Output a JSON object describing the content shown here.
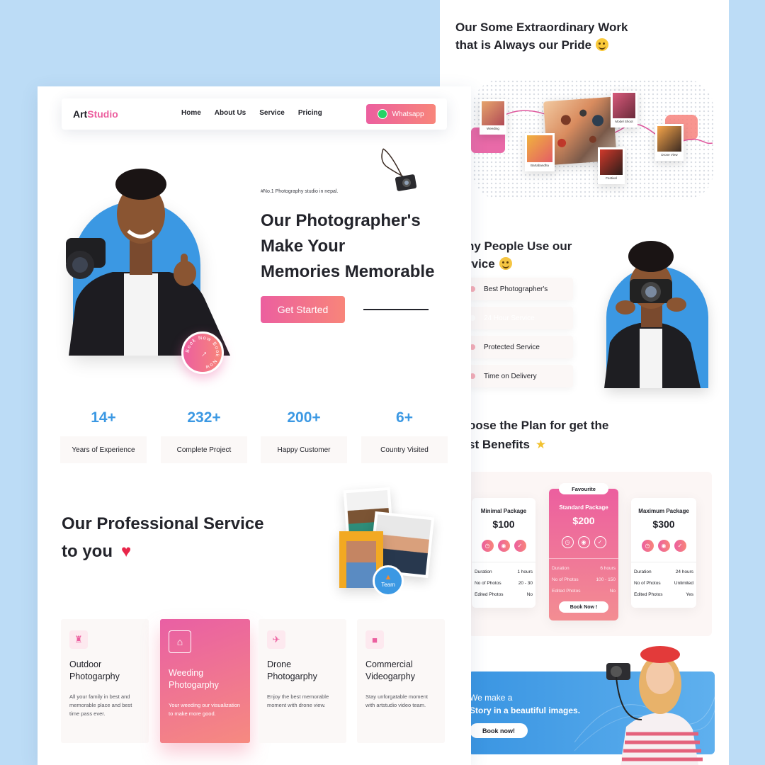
{
  "brand": {
    "name_dark": "Art",
    "name_pink": "Studio"
  },
  "nav": {
    "links": [
      "Home",
      "About Us",
      "Service",
      "Pricing"
    ],
    "whatsapp_label": "Whatsapp"
  },
  "hero": {
    "tagline": "#No.1 Photography studio in nepal.",
    "title_lines": [
      "Our Photographer's",
      "Make Your",
      "Memories Memorable"
    ],
    "cta_label": "Get Started",
    "badge_text": "Book Now Book Now"
  },
  "stats": [
    {
      "value": "14+",
      "label": "Years of Experience"
    },
    {
      "value": "232+",
      "label": "Complete Project"
    },
    {
      "value": "200+",
      "label": "Happy Customer"
    },
    {
      "value": "6+",
      "label": "Country Visited"
    }
  ],
  "services": {
    "title_line1": "Our Professional Service",
    "title_line2": "to you",
    "team_badge": "Team",
    "cards": [
      {
        "title": "Outdoor Photogarphy",
        "desc": "All your family in best and memorable place and best time pass ever.",
        "icon": "family-icon"
      },
      {
        "title": "Weeding Photogarphy",
        "desc": "Your weeding our visualization to make more good.",
        "icon": "wedding-icon"
      },
      {
        "title": "Drone Photogarphy",
        "desc": "Enjoy the best memorable moment with drone view.",
        "icon": "drone-icon"
      },
      {
        "title": "Commercial Videogarphy",
        "desc": "Stay unforgatable moment with artstudio video team.",
        "icon": "video-camera-icon"
      }
    ]
  },
  "work": {
    "title_line1": "Our Some Extraordinary Work",
    "title_line2": "that is Always our Pride",
    "photos": [
      "Weeding",
      "Model Shoot",
      "Bartabandha",
      "Festival",
      "Drone View"
    ]
  },
  "why": {
    "title_line1": "hy People Use our",
    "title_line2": "rvice",
    "items": [
      "Best Photographer's",
      "24 Hour Service",
      "Protected Service",
      "Time on Delivery"
    ]
  },
  "plans": {
    "title_line1": "oose the Plan for get the",
    "title_line2": "st Benefits",
    "favourite_label": "Favourite",
    "cards": [
      {
        "name": "Minimal Package",
        "price": "$100",
        "rows": [
          [
            "Duration",
            "1 hours"
          ],
          [
            "No of Photos",
            "20 - 30"
          ],
          [
            "Edited Photos",
            "No"
          ]
        ]
      },
      {
        "name": "Standard Package",
        "price": "$200",
        "rows": [
          [
            "Duration",
            "6 hours"
          ],
          [
            "No of Photos",
            "100 - 150"
          ],
          [
            "Edited Photos",
            "No"
          ]
        ],
        "button": "Book Now !"
      },
      {
        "name": "Maximum Package",
        "price": "$300",
        "rows": [
          [
            "Duration",
            "24 hours"
          ],
          [
            "No of Photos",
            "Unlimited"
          ],
          [
            "Edited Photos",
            "Yes"
          ]
        ]
      }
    ]
  },
  "banner": {
    "line1": "We make a",
    "line2": "Story in a beautiful images.",
    "button": "Book now!"
  },
  "colors": {
    "accent_pink": "#ec5f9f",
    "accent_coral": "#f8857a",
    "blue": "#3b98e3",
    "bg": "#bcdcf6"
  }
}
